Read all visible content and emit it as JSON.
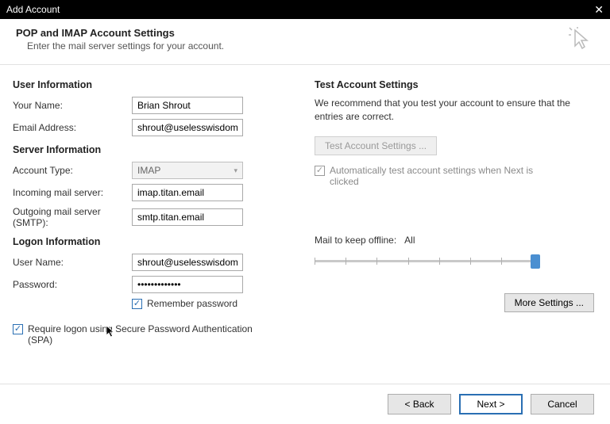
{
  "titlebar": {
    "title": "Add Account"
  },
  "header": {
    "title": "POP and IMAP Account Settings",
    "subtitle": "Enter the mail server settings for your account."
  },
  "left": {
    "user_info_title": "User Information",
    "your_name_label": "Your Name:",
    "your_name_value": "Brian Shrout",
    "email_label": "Email Address:",
    "email_value": "shrout@uselesswisdom.com",
    "server_info_title": "Server Information",
    "account_type_label": "Account Type:",
    "account_type_value": "IMAP",
    "incoming_label": "Incoming mail server:",
    "incoming_value": "imap.titan.email",
    "outgoing_label": "Outgoing mail server (SMTP):",
    "outgoing_value": "smtp.titan.email",
    "logon_info_title": "Logon Information",
    "username_label": "User Name:",
    "username_value": "shrout@uselesswisdom.com",
    "password_label": "Password:",
    "password_value": "*************",
    "remember_label": "Remember password",
    "spa_label": "Require logon using Secure Password Authentication (SPA)"
  },
  "right": {
    "test_title": "Test Account Settings",
    "test_desc": "We recommend that you test your account to ensure that the entries are correct.",
    "test_button": "Test Account Settings ...",
    "auto_test_label": "Automatically test account settings when Next is clicked",
    "mail_offline_label": "Mail to keep offline:",
    "mail_offline_value": "All",
    "more_settings": "More Settings ..."
  },
  "footer": {
    "back": "< Back",
    "next": "Next >",
    "cancel": "Cancel"
  }
}
